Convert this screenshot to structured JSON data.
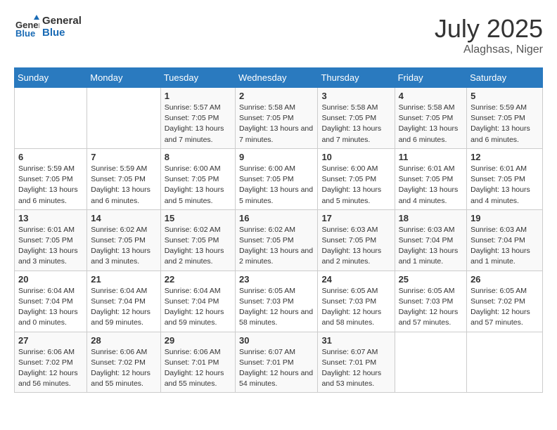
{
  "header": {
    "logo_line1": "General",
    "logo_line2": "Blue",
    "month": "July 2025",
    "location": "Alaghsas, Niger"
  },
  "days_of_week": [
    "Sunday",
    "Monday",
    "Tuesday",
    "Wednesday",
    "Thursday",
    "Friday",
    "Saturday"
  ],
  "weeks": [
    [
      {
        "day": "",
        "info": ""
      },
      {
        "day": "",
        "info": ""
      },
      {
        "day": "1",
        "info": "Sunrise: 5:57 AM\nSunset: 7:05 PM\nDaylight: 13 hours and 7 minutes."
      },
      {
        "day": "2",
        "info": "Sunrise: 5:58 AM\nSunset: 7:05 PM\nDaylight: 13 hours and 7 minutes."
      },
      {
        "day": "3",
        "info": "Sunrise: 5:58 AM\nSunset: 7:05 PM\nDaylight: 13 hours and 7 minutes."
      },
      {
        "day": "4",
        "info": "Sunrise: 5:58 AM\nSunset: 7:05 PM\nDaylight: 13 hours and 6 minutes."
      },
      {
        "day": "5",
        "info": "Sunrise: 5:59 AM\nSunset: 7:05 PM\nDaylight: 13 hours and 6 minutes."
      }
    ],
    [
      {
        "day": "6",
        "info": "Sunrise: 5:59 AM\nSunset: 7:05 PM\nDaylight: 13 hours and 6 minutes."
      },
      {
        "day": "7",
        "info": "Sunrise: 5:59 AM\nSunset: 7:05 PM\nDaylight: 13 hours and 6 minutes."
      },
      {
        "day": "8",
        "info": "Sunrise: 6:00 AM\nSunset: 7:05 PM\nDaylight: 13 hours and 5 minutes."
      },
      {
        "day": "9",
        "info": "Sunrise: 6:00 AM\nSunset: 7:05 PM\nDaylight: 13 hours and 5 minutes."
      },
      {
        "day": "10",
        "info": "Sunrise: 6:00 AM\nSunset: 7:05 PM\nDaylight: 13 hours and 5 minutes."
      },
      {
        "day": "11",
        "info": "Sunrise: 6:01 AM\nSunset: 7:05 PM\nDaylight: 13 hours and 4 minutes."
      },
      {
        "day": "12",
        "info": "Sunrise: 6:01 AM\nSunset: 7:05 PM\nDaylight: 13 hours and 4 minutes."
      }
    ],
    [
      {
        "day": "13",
        "info": "Sunrise: 6:01 AM\nSunset: 7:05 PM\nDaylight: 13 hours and 3 minutes."
      },
      {
        "day": "14",
        "info": "Sunrise: 6:02 AM\nSunset: 7:05 PM\nDaylight: 13 hours and 3 minutes."
      },
      {
        "day": "15",
        "info": "Sunrise: 6:02 AM\nSunset: 7:05 PM\nDaylight: 13 hours and 2 minutes."
      },
      {
        "day": "16",
        "info": "Sunrise: 6:02 AM\nSunset: 7:05 PM\nDaylight: 13 hours and 2 minutes."
      },
      {
        "day": "17",
        "info": "Sunrise: 6:03 AM\nSunset: 7:05 PM\nDaylight: 13 hours and 2 minutes."
      },
      {
        "day": "18",
        "info": "Sunrise: 6:03 AM\nSunset: 7:04 PM\nDaylight: 13 hours and 1 minute."
      },
      {
        "day": "19",
        "info": "Sunrise: 6:03 AM\nSunset: 7:04 PM\nDaylight: 13 hours and 1 minute."
      }
    ],
    [
      {
        "day": "20",
        "info": "Sunrise: 6:04 AM\nSunset: 7:04 PM\nDaylight: 13 hours and 0 minutes."
      },
      {
        "day": "21",
        "info": "Sunrise: 6:04 AM\nSunset: 7:04 PM\nDaylight: 12 hours and 59 minutes."
      },
      {
        "day": "22",
        "info": "Sunrise: 6:04 AM\nSunset: 7:04 PM\nDaylight: 12 hours and 59 minutes."
      },
      {
        "day": "23",
        "info": "Sunrise: 6:05 AM\nSunset: 7:03 PM\nDaylight: 12 hours and 58 minutes."
      },
      {
        "day": "24",
        "info": "Sunrise: 6:05 AM\nSunset: 7:03 PM\nDaylight: 12 hours and 58 minutes."
      },
      {
        "day": "25",
        "info": "Sunrise: 6:05 AM\nSunset: 7:03 PM\nDaylight: 12 hours and 57 minutes."
      },
      {
        "day": "26",
        "info": "Sunrise: 6:05 AM\nSunset: 7:02 PM\nDaylight: 12 hours and 57 minutes."
      }
    ],
    [
      {
        "day": "27",
        "info": "Sunrise: 6:06 AM\nSunset: 7:02 PM\nDaylight: 12 hours and 56 minutes."
      },
      {
        "day": "28",
        "info": "Sunrise: 6:06 AM\nSunset: 7:02 PM\nDaylight: 12 hours and 55 minutes."
      },
      {
        "day": "29",
        "info": "Sunrise: 6:06 AM\nSunset: 7:01 PM\nDaylight: 12 hours and 55 minutes."
      },
      {
        "day": "30",
        "info": "Sunrise: 6:07 AM\nSunset: 7:01 PM\nDaylight: 12 hours and 54 minutes."
      },
      {
        "day": "31",
        "info": "Sunrise: 6:07 AM\nSunset: 7:01 PM\nDaylight: 12 hours and 53 minutes."
      },
      {
        "day": "",
        "info": ""
      },
      {
        "day": "",
        "info": ""
      }
    ]
  ]
}
